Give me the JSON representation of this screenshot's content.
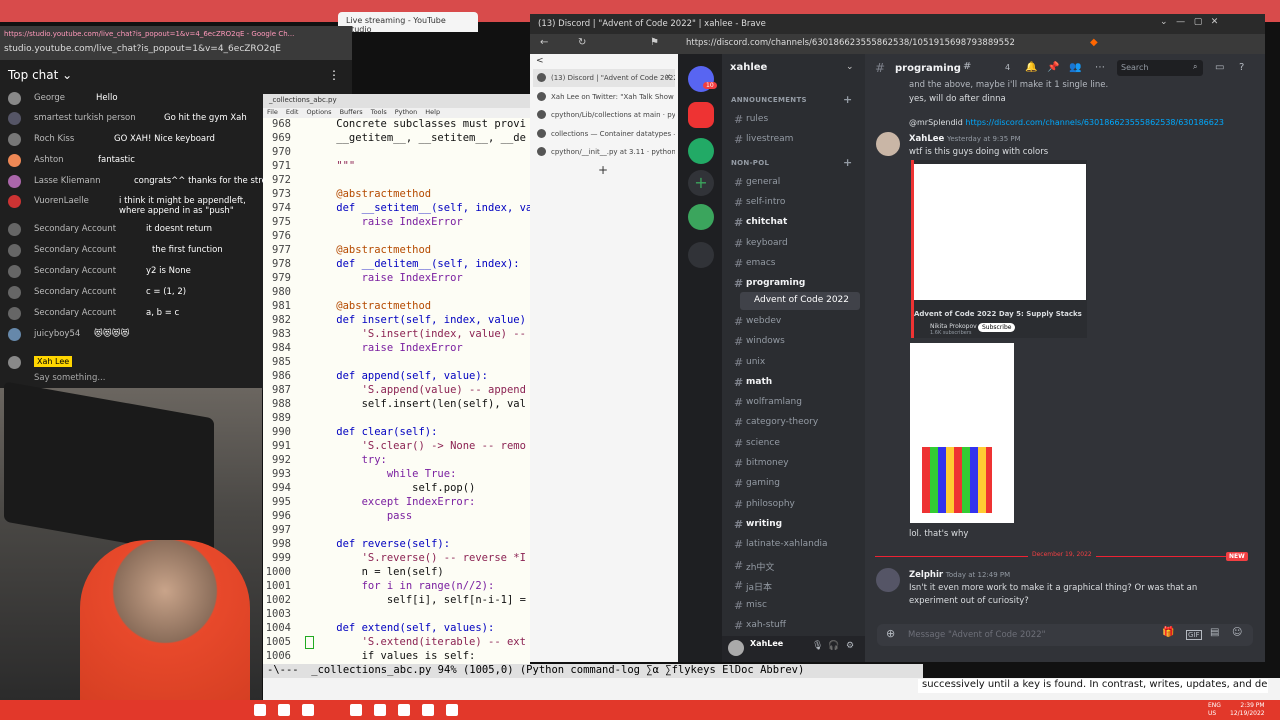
{
  "windows": {
    "youtube_tab": "Live streaming - YouTube Studio",
    "chat_popup_url": "studio.youtube.com/live_chat?is_popout=1&v=4_6ecZRO2qE",
    "chat_popup_title": "https://studio.youtube.com/live_chat?is_popout=1&v=4_6ecZRO2qE - Google Ch...",
    "brave_title": "(13) Discord | \"Advent of Code 2022\" | xahlee - Brave",
    "brave_url": "https://discord.com/channels/630186623555862538/1051915698793889552"
  },
  "chat": {
    "header": "Top chat",
    "messages": [
      {
        "author": "George",
        "text": "Hello"
      },
      {
        "author": "smartest turkish person",
        "text": "Go hit the gym Xah"
      },
      {
        "author": "Roch Kiss",
        "text": "GO XAH! Nice keyboard"
      },
      {
        "author": "Ashton",
        "text": "fantastic"
      },
      {
        "author": "Lasse Kliemann",
        "text": "congrats^^ thanks for the streams."
      },
      {
        "author": "VuorenLaelle",
        "text": "i think it might be appendleft, where append in as \"push\""
      },
      {
        "author": "Secondary Account",
        "text": "it doesnt return"
      },
      {
        "author": "Secondary Account",
        "text": "the first function"
      },
      {
        "author": "Secondary Account",
        "text": "y2 is None"
      },
      {
        "author": "Secondary Account",
        "text": "c = (1, 2)"
      },
      {
        "author": "Secondary Account",
        "text": "a, b = c"
      },
      {
        "author": "juicyboy54",
        "text": "😻😻😻😻"
      }
    ],
    "current_user": "Xah Lee",
    "input_placeholder": "Say something..."
  },
  "emacs": {
    "title": "_collections_abc.py",
    "menu": [
      "File",
      "Edit",
      "Options",
      "Buffers",
      "Tools",
      "Python",
      "Help"
    ],
    "lines": [
      {
        "n": "968",
        "t": "    Concrete subclasses must provi"
      },
      {
        "n": "969",
        "t": "    __getitem__, __setitem__, __de"
      },
      {
        "n": "970",
        "t": ""
      },
      {
        "n": "971",
        "t": "    \"\"\""
      },
      {
        "n": "972",
        "t": ""
      },
      {
        "n": "973",
        "t": "    @abstractmethod"
      },
      {
        "n": "974",
        "t": "    def __setitem__(self, index, va"
      },
      {
        "n": "975",
        "t": "        raise IndexError"
      },
      {
        "n": "976",
        "t": ""
      },
      {
        "n": "977",
        "t": "    @abstractmethod"
      },
      {
        "n": "978",
        "t": "    def __delitem__(self, index):"
      },
      {
        "n": "979",
        "t": "        raise IndexError"
      },
      {
        "n": "980",
        "t": ""
      },
      {
        "n": "981",
        "t": "    @abstractmethod"
      },
      {
        "n": "982",
        "t": "    def insert(self, index, value)"
      },
      {
        "n": "983",
        "t": "        'S.insert(index, value) --"
      },
      {
        "n": "984",
        "t": "        raise IndexError"
      },
      {
        "n": "985",
        "t": ""
      },
      {
        "n": "986",
        "t": "    def append(self, value):"
      },
      {
        "n": "987",
        "t": "        'S.append(value) -- append"
      },
      {
        "n": "988",
        "t": "        self.insert(len(self), val"
      },
      {
        "n": "989",
        "t": ""
      },
      {
        "n": "990",
        "t": "    def clear(self):"
      },
      {
        "n": "991",
        "t": "        'S.clear() -> None -- remo"
      },
      {
        "n": "992",
        "t": "        try:"
      },
      {
        "n": "993",
        "t": "            while True:"
      },
      {
        "n": "994",
        "t": "                self.pop()"
      },
      {
        "n": "995",
        "t": "        except IndexError:"
      },
      {
        "n": "996",
        "t": "            pass"
      },
      {
        "n": "997",
        "t": ""
      },
      {
        "n": "998",
        "t": "    def reverse(self):"
      },
      {
        "n": "999",
        "t": "        'S.reverse() -- reverse *I"
      },
      {
        "n": "1000",
        "t": "        n = len(self)"
      },
      {
        "n": "1001",
        "t": "        for i in range(n//2):"
      },
      {
        "n": "1002",
        "t": "            self[i], self[n-i-1] ="
      },
      {
        "n": "1003",
        "t": ""
      },
      {
        "n": "1004",
        "t": "    def extend(self, values):"
      },
      {
        "n": "1005",
        "t": "        'S.extend(iterable) -- ext"
      },
      {
        "n": "1006",
        "t": "        if values is self:"
      }
    ],
    "modeline": "-\\---  _collections_abc.py 94% (1005,0) (Python command-log ∑α ∑flykeys ElDoc Abbrev)",
    "docline": "successively until a key is found. In contrast, writes, updates, and deletions"
  },
  "brave_tabs": [
    {
      "label": "(13) Discord | \"Advent of Code 2022\"",
      "active": true
    },
    {
      "label": "Xah Lee on Twitter: \"Xah Talk Show To...",
      "active": false
    },
    {
      "label": "cpython/Lib/collections at main · pyth...",
      "active": false
    },
    {
      "label": "collections — Container datatypes —...",
      "active": false
    },
    {
      "label": "cpython/__init__.py at 3.11 · python/cp...",
      "active": false
    }
  ],
  "discord": {
    "server": "xahlee",
    "badge": "10",
    "categories": [
      {
        "name": "ANNOUNCEMENTS",
        "channels": [
          "rules",
          "livestream"
        ]
      },
      {
        "name": "NON-POL",
        "channels": [
          "general",
          "self-intro",
          "chitchat",
          "keyboard",
          "emacs",
          "programing"
        ]
      }
    ],
    "thread": "Advent of Code 2022",
    "more_channels": [
      "webdev",
      "windows",
      "unix",
      "math",
      "wolframlang",
      "category-theory",
      "science",
      "bitmoney",
      "gaming",
      "philosophy",
      "writing",
      "latinate-xahlandia",
      "zh中文",
      "ja日本",
      "misc",
      "xah-stuff"
    ],
    "header_channel": "programing",
    "header_thread_count": "4",
    "search_placeholder": "Search",
    "messages": {
      "partial_1": "and the above, maybe i'll make it 1 single line.",
      "partial_2": "yes, will do after dinna",
      "reply_to": "@mrSplendid",
      "reply_link": "https://discord.com/channels/630186623555862538/630186623",
      "m1_author": "XahLee",
      "m1_time": "Yesterday at 9:35 PM",
      "m1_text": "wtf is this guys doing with colors",
      "embed_title": "Advent of Code 2022 Day 5: Supply Stacks",
      "embed_channel": "Nikita Prokopov",
      "embed_subs": "1.6K subscribers",
      "embed_subscribe": "Subscribe",
      "m1_text2": "lol. that's why",
      "date_divider": "December 19, 2022",
      "new_label": "NEW",
      "m2_author": "Zelphir",
      "m2_time": "Today at 12:49 PM",
      "m2_text_1": "Isn't it even more work to make it a graphical thing? Or was that an",
      "m2_text_2": "experiment out of curiosity?"
    },
    "input_placeholder": "Message \"Advent of Code 2022\"",
    "user": "XahLee"
  },
  "taskbar": {
    "lang": "ENG",
    "region": "US",
    "time": "2:39 PM",
    "date": "12/19/2022"
  }
}
